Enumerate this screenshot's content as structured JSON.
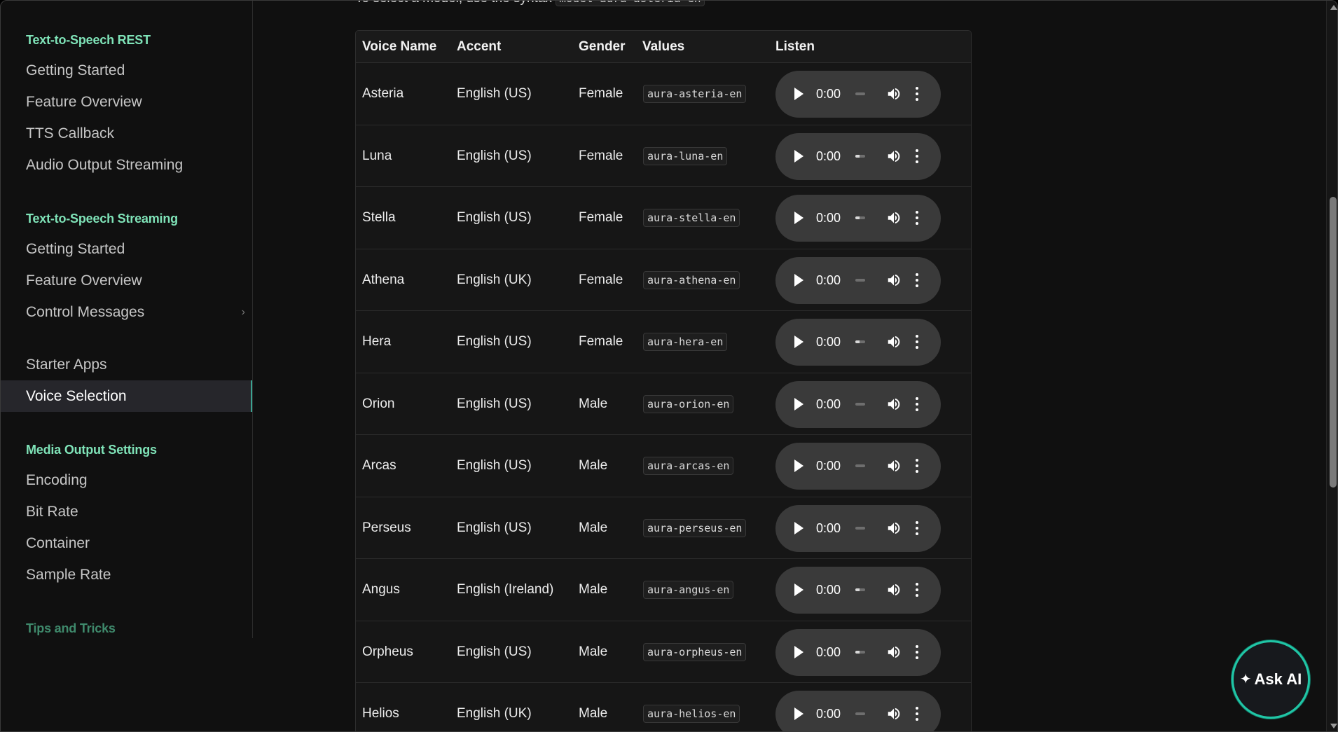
{
  "intro": {
    "prefix": "To select a model, use the syntax ",
    "code": "model=aura-asteria-en"
  },
  "sidebar": {
    "sections": [
      {
        "title": "Text-to-Speech REST",
        "items": [
          {
            "label": "Getting Started"
          },
          {
            "label": "Feature Overview"
          },
          {
            "label": "TTS Callback"
          },
          {
            "label": "Audio Output Streaming"
          }
        ]
      },
      {
        "title": "Text-to-Speech Streaming",
        "items": [
          {
            "label": "Getting Started"
          },
          {
            "label": "Feature Overview"
          },
          {
            "label": "Control Messages",
            "expandable": true
          }
        ]
      },
      {
        "title": "",
        "items": [
          {
            "label": "Starter Apps"
          },
          {
            "label": "Voice Selection",
            "active": true
          }
        ]
      },
      {
        "title": "Media Output Settings",
        "items": [
          {
            "label": "Encoding"
          },
          {
            "label": "Bit Rate"
          },
          {
            "label": "Container"
          },
          {
            "label": "Sample Rate"
          }
        ]
      },
      {
        "title": "Tips and Tricks",
        "items": []
      }
    ]
  },
  "table": {
    "headers": [
      "Voice Name",
      "Accent",
      "Gender",
      "Values",
      "Listen"
    ],
    "rows": [
      {
        "name": "Asteria",
        "accent": "English (US)",
        "gender": "Female",
        "value": "aura-asteria-en",
        "time": "0:00",
        "progress": 0.0
      },
      {
        "name": "Luna",
        "accent": "English (US)",
        "gender": "Female",
        "value": "aura-luna-en",
        "time": "0:00",
        "progress": 0.4
      },
      {
        "name": "Stella",
        "accent": "English (US)",
        "gender": "Female",
        "value": "aura-stella-en",
        "time": "0:00",
        "progress": 0.4
      },
      {
        "name": "Athena",
        "accent": "English (UK)",
        "gender": "Female",
        "value": "aura-athena-en",
        "time": "0:00",
        "progress": 0.0
      },
      {
        "name": "Hera",
        "accent": "English (US)",
        "gender": "Female",
        "value": "aura-hera-en",
        "time": "0:00",
        "progress": 0.4
      },
      {
        "name": "Orion",
        "accent": "English (US)",
        "gender": "Male",
        "value": "aura-orion-en",
        "time": "0:00",
        "progress": 0.0
      },
      {
        "name": "Arcas",
        "accent": "English (US)",
        "gender": "Male",
        "value": "aura-arcas-en",
        "time": "0:00",
        "progress": 0.0
      },
      {
        "name": "Perseus",
        "accent": "English (US)",
        "gender": "Male",
        "value": "aura-perseus-en",
        "time": "0:00",
        "progress": 0.0
      },
      {
        "name": "Angus",
        "accent": "English (Ireland)",
        "gender": "Male",
        "value": "aura-angus-en",
        "time": "0:00",
        "progress": 0.4
      },
      {
        "name": "Orpheus",
        "accent": "English (US)",
        "gender": "Male",
        "value": "aura-orpheus-en",
        "time": "0:00",
        "progress": 0.4
      },
      {
        "name": "Helios",
        "accent": "English (UK)",
        "gender": "Male",
        "value": "aura-helios-en",
        "time": "0:00",
        "progress": 0.0
      }
    ]
  },
  "ask_ai": {
    "label": "Ask AI",
    "icon": "sparkle-icon"
  },
  "colors": {
    "accent": "#7fe3b8",
    "ask_ai_ring": "#20c6a6"
  }
}
